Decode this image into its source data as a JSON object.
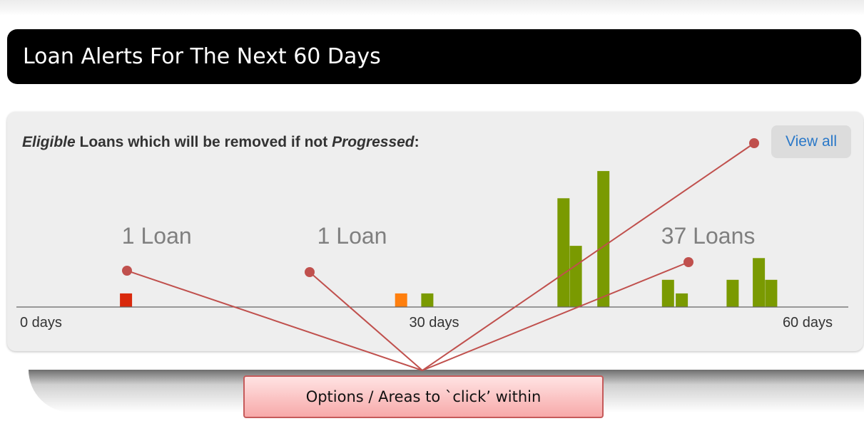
{
  "header": {
    "title": "Loan Alerts For The Next 60 Days"
  },
  "panel": {
    "heading_part1": "Eligible",
    "heading_part2": " Loans which will be removed if not ",
    "heading_part3": "Progressed",
    "heading_part4": ":",
    "view_all_label": "View all"
  },
  "callout": {
    "label": "Options / Areas to `click’ within"
  },
  "chart_data": {
    "type": "bar",
    "x_tick_labels": [
      "0 days",
      "30 days",
      "60 days"
    ],
    "x_domain": [
      0,
      60
    ],
    "group_labels": [
      {
        "text": "1 Loan",
        "day": 7.3
      },
      {
        "text": "1 Loan",
        "day": 21.5
      },
      {
        "text": "37 Loans",
        "day": 46.5
      }
    ],
    "bars": [
      {
        "day": 7.6,
        "value": 1,
        "color": "#d9290c"
      },
      {
        "day": 27.6,
        "value": 1,
        "color": "#ff7f0e"
      },
      {
        "day": 29.5,
        "value": 1,
        "color": "#7a9a01"
      },
      {
        "day": 39.4,
        "value": 8,
        "color": "#7a9a01"
      },
      {
        "day": 40.3,
        "value": 4.5,
        "color": "#7a9a01"
      },
      {
        "day": 42.3,
        "value": 10,
        "color": "#7a9a01"
      },
      {
        "day": 47.0,
        "value": 2,
        "color": "#7a9a01"
      },
      {
        "day": 48.0,
        "value": 1,
        "color": "#7a9a01"
      },
      {
        "day": 51.7,
        "value": 2,
        "color": "#7a9a01"
      },
      {
        "day": 53.6,
        "value": 3.6,
        "color": "#7a9a01"
      },
      {
        "day": 54.5,
        "value": 2,
        "color": "#7a9a01"
      }
    ],
    "y_domain": [
      0,
      11
    ]
  },
  "colors": {
    "annotation_line": "#c0504d",
    "axis": "#666666",
    "group_label": "#7f7f7f"
  }
}
